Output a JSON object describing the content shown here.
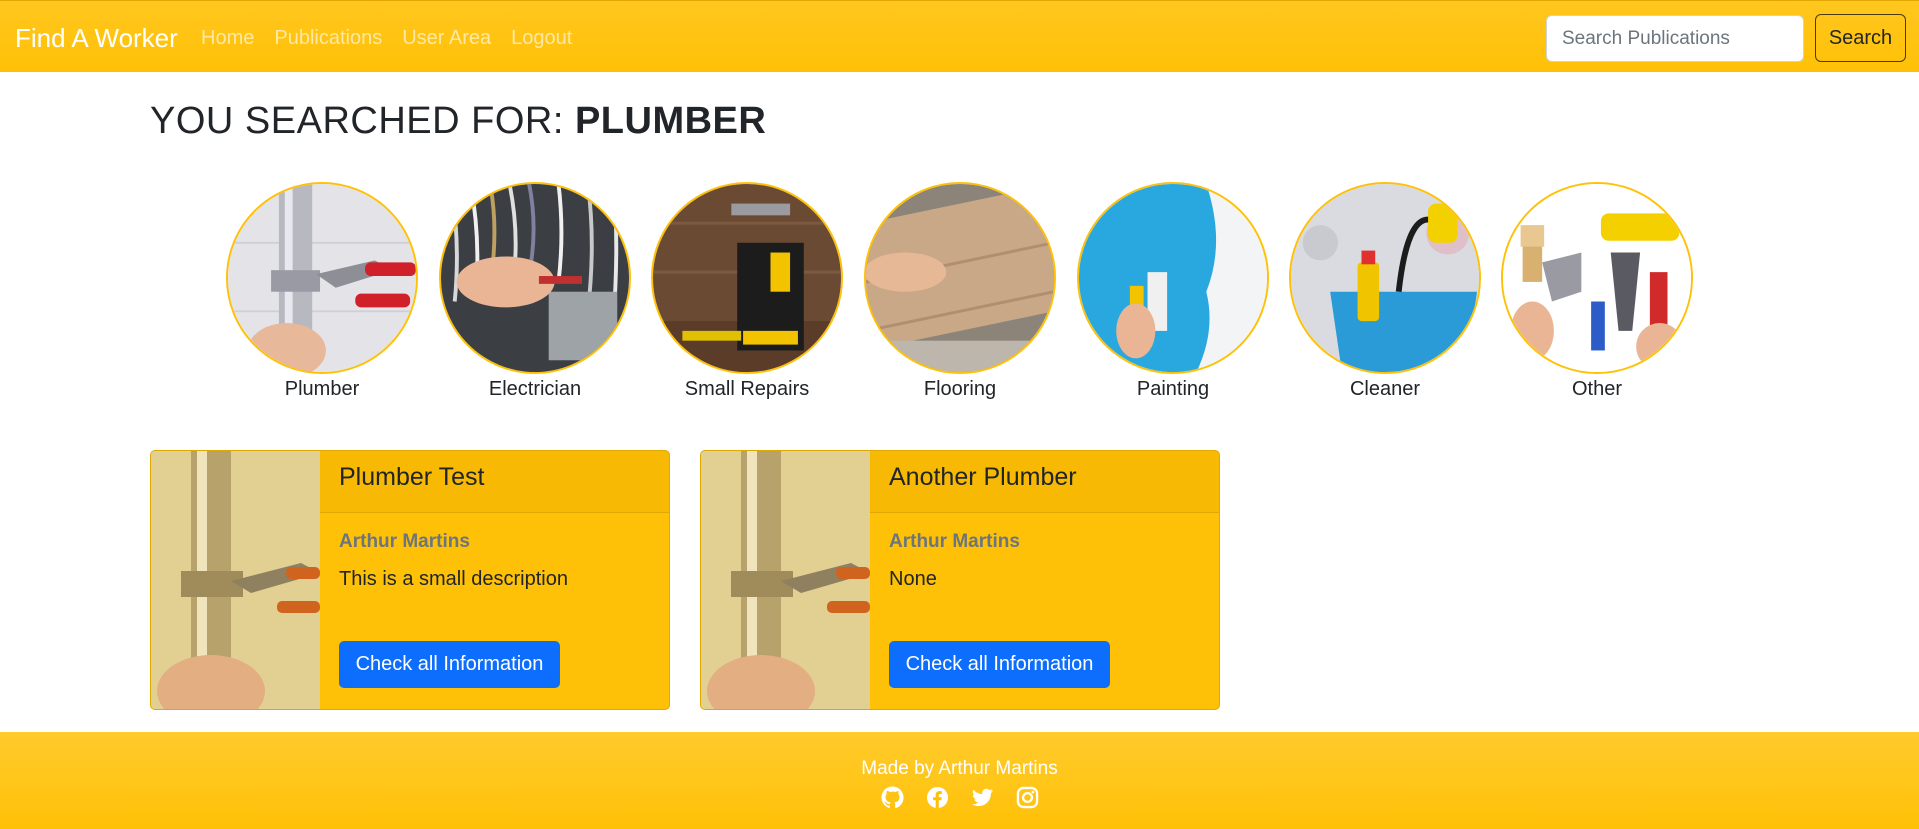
{
  "navbar": {
    "brand": "Find A Worker",
    "links": [
      "Home",
      "Publications",
      "User Area",
      "Logout"
    ],
    "search_placeholder": "Search Publications",
    "search_button": "Search"
  },
  "search": {
    "prefix": "YOU SEARCHED FOR: ",
    "term": "PLUMBER"
  },
  "categories": [
    {
      "label": "Plumber",
      "icon": "plumber-photo"
    },
    {
      "label": "Electrician",
      "icon": "electrician-photo"
    },
    {
      "label": "Small Repairs",
      "icon": "toolbox-photo"
    },
    {
      "label": "Flooring",
      "icon": "flooring-photo"
    },
    {
      "label": "Painting",
      "icon": "paint-roller-photo"
    },
    {
      "label": "Cleaner",
      "icon": "cleaning-bucket-photo"
    },
    {
      "label": "Other",
      "icon": "assorted-tools-photo"
    }
  ],
  "results": [
    {
      "title": "Plumber Test",
      "author": "Arthur Martins",
      "description": "This is a small description",
      "button": "Check all Information"
    },
    {
      "title": "Another Plumber",
      "author": "Arthur Martins",
      "description": "None",
      "button": "Check all Information"
    }
  ],
  "footer": {
    "text": "Made by Arthur Martins",
    "socials": [
      "github-icon",
      "facebook-icon",
      "twitter-icon",
      "instagram-icon"
    ]
  },
  "colors": {
    "accent": "#ffc107",
    "primary_button": "#0d6efd",
    "muted_text": "#6c757d"
  }
}
